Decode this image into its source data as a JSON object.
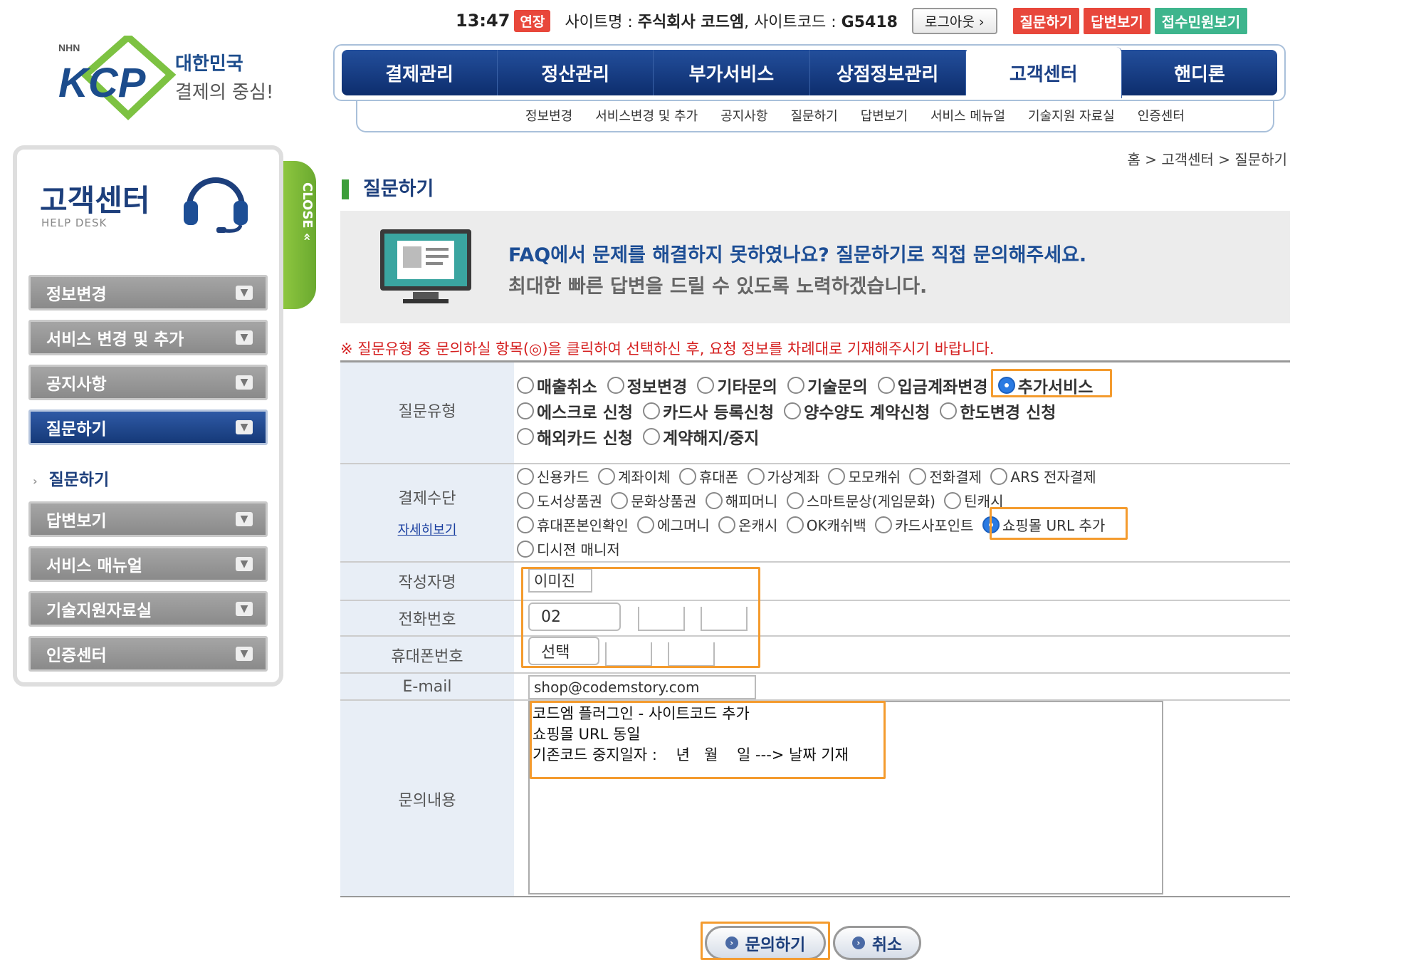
{
  "topbar": {
    "time": "13:47",
    "extend": "연장",
    "site_label": "사이트명 : ",
    "site_name": "주식회사 코드엠",
    "site_code_label": ", 사이트코드 : ",
    "site_code": "G5418",
    "logout": "로그아웃 ›",
    "btn_ask": "질문하기",
    "btn_answer": "답변보기",
    "btn_complaint": "접수민원보기",
    "colors": {
      "ask": "#e8473b",
      "answer": "#e8473b",
      "complaint": "#3eb58d"
    }
  },
  "logo": {
    "brand": "KCP",
    "nhn": "NHN",
    "line1": "대한민국",
    "line2": "결제의 중심!"
  },
  "gnb": {
    "items": [
      "결제관리",
      "정산관리",
      "부가서비스",
      "상점정보관리",
      "고객센터",
      "핸디론"
    ],
    "sub": [
      "정보변경",
      "서비스변경 및 추가",
      "공지사항",
      "질문하기",
      "답변보기",
      "서비스 메뉴얼",
      "기술지원 자료실",
      "인증센터"
    ]
  },
  "breadcrumb": "홈 > 고객센터 > 질문하기",
  "sidebar": {
    "title": "고객센터",
    "subtitle": "HELP DESK",
    "close": "CLOSE «",
    "menu": [
      "정보변경",
      "서비스 변경 및 추가",
      "공지사항",
      "질문하기",
      "답변보기",
      "서비스 매뉴얼",
      "기술지원자료실",
      "인증센터"
    ],
    "active_sub": "질문하기"
  },
  "page": {
    "title": "질문하기",
    "banner_line1": "FAQ에서 문제를 해결하지 못하였나요? 질문하기로 직접 문의해주세요.",
    "banner_line2": "최대한 빠른 답변을 드릴 수 있도록 노력하겠습니다.",
    "notice": "※ 질문유형 중 문의하실 항목(◎)을 클릭하여 선택하신 후, 요청 정보를 차례대로 기재해주시기 바랍니다."
  },
  "form": {
    "qtype_label": "질문유형",
    "qtypes_row1": [
      "매출취소",
      "정보변경",
      "기타문의",
      "기술문의",
      "입금계좌변경",
      "추가서비스"
    ],
    "qtypes_row2": [
      "에스크로 신청",
      "카드사 등록신청",
      "양수양도 계약신청",
      "한도변경 신청"
    ],
    "qtypes_row3": [
      "해외카드 신청",
      "계약해지/중지"
    ],
    "qtype_selected": "추가서비스",
    "pay_label": "결제수단",
    "pay_detail": "자세히보기",
    "pay_row1": [
      "신용카드",
      "계좌이체",
      "휴대폰",
      "가상계좌",
      "모모캐쉬",
      "전화결제",
      "ARS 전자결제"
    ],
    "pay_row2": [
      "도서상품권",
      "문화상품권",
      "해피머니",
      "스마트문상(게임문화)",
      "틴캐시"
    ],
    "pay_row3": [
      "휴대폰본인확인",
      "에그머니",
      "온캐시",
      "OK캐쉬백",
      "카드사포인트",
      "쇼핑몰 URL 추가"
    ],
    "pay_row4": [
      "디시젼 매니저"
    ],
    "pay_selected": "쇼핑몰 URL 추가",
    "name_label": "작성자명",
    "name_value": "이미진",
    "phone_label": "전화번호",
    "phone_value": "02",
    "mobile_label": "휴대폰번호",
    "mobile_value": "선택",
    "email_label": "E-mail",
    "email_value": "shop@codemstory.com",
    "content_label": "문의내용",
    "content_value": "코드엠 플러그인 - 사이트코드 추가\n쇼핑몰 URL 동일\n기존코드 중지일자 :    년   월    일 ---> 날짜 기재",
    "submit": "문의하기",
    "cancel": "취소"
  },
  "highlight_color": "#f49b2e"
}
